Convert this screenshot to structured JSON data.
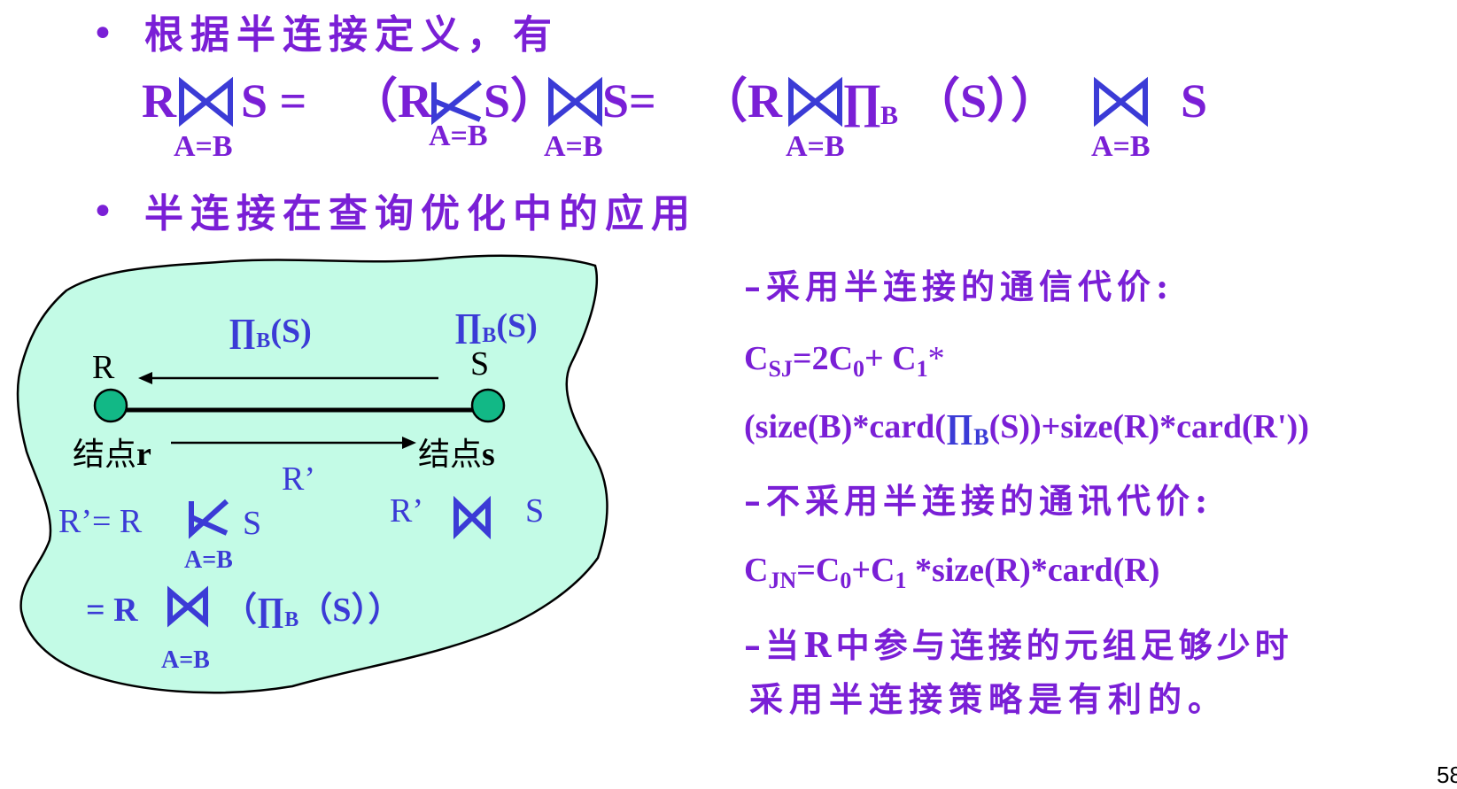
{
  "section1": {
    "bullet": "•",
    "heading": "根据半连接定义，有",
    "formula": {
      "t1": "R",
      "t2": "S =",
      "t3": "（R",
      "t4": "S）",
      "t5": "S=",
      "t6": "（R",
      "t7": "∏",
      "t8": "B",
      "t9": "（S））",
      "t10": "S",
      "sub1": "A=B",
      "sub2": "A=B",
      "sub3": "A=B",
      "sub4": "A=B",
      "sub5": "A=B"
    }
  },
  "section2": {
    "bullet": "•",
    "heading": "半连接在查询优化中的应用"
  },
  "diagram": {
    "proj_top_left": {
      "pi": "∏",
      "sub": "B",
      "rest": "(S)"
    },
    "proj_top_right": {
      "pi": "∏",
      "sub": "B",
      "rest": "(S)"
    },
    "node_r_label": "R",
    "node_s_label": "S",
    "site_r": {
      "text": "结点",
      "var": "r"
    },
    "site_s": {
      "text": "结点",
      "var": "s"
    },
    "r_prime_mid": "R’",
    "eq1_left": "R’= R",
    "eq1_right": "S",
    "eq1_sub": "A=B",
    "eq2_left": "R’",
    "eq2_right": "S",
    "eq3_prefix": "= R",
    "eq3_paren": "（∏",
    "eq3_sub": "B",
    "eq3_rest": "（S））",
    "eq3_cond": "A=B",
    "colors": {
      "fill": "#c3fbe6",
      "node": "#12b886",
      "text_blue": "#3b3bd6"
    }
  },
  "right": {
    "h1": "–采用半连接的通信代价:",
    "f1": {
      "c": "C",
      "sub_sj": "SJ",
      "mid": "=2C",
      "sub0": "0",
      "plus": "+ C",
      "sub1": "1",
      "star": "*"
    },
    "f2": {
      "a": "(size(B)*card(",
      "pi": "∏",
      "sub": "B",
      "b": "(S))+size(R)*card(R'))"
    },
    "h2": "–不采用半连接的通讯代价:",
    "f3": {
      "c": "C",
      "sub_jn": "JN",
      "mid": "=C",
      "sub0": "0",
      "plus": "+C",
      "sub1": "1",
      "rest": " *size(R)*card(R)"
    },
    "h3_line1": "–当R中参与连接的元组足够少时",
    "h3_line2": "采用半连接策略是有利的。"
  },
  "page_number": "58",
  "colors": {
    "purple": "#7a1fd6",
    "blue": "#3b3bd6"
  }
}
